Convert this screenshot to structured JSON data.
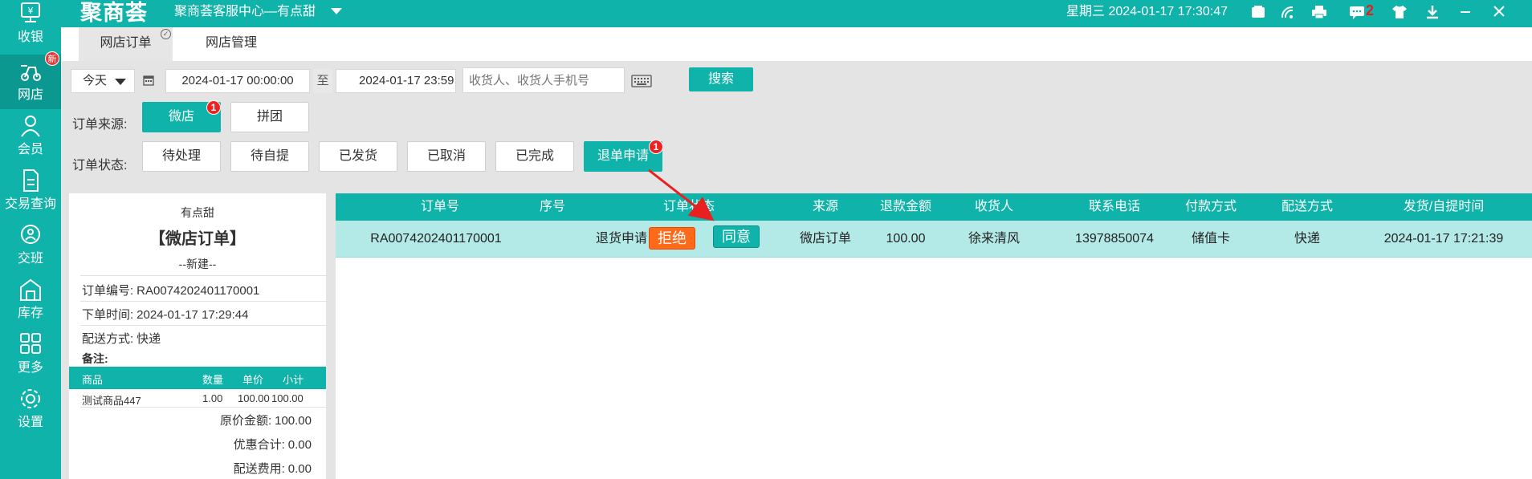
{
  "app": {
    "logo": "聚商荟",
    "store_title": "聚商荟客服中心—有点甜",
    "datetime": "星期三 2024-01-17 17:30:47",
    "message_count": "2",
    "accent_color": "#0fb3a9"
  },
  "sidebar": {
    "items": [
      {
        "label": "收银",
        "icon": "cashier-icon"
      },
      {
        "label": "网店",
        "icon": "online-store-icon",
        "badge": "新"
      },
      {
        "label": "会员",
        "icon": "member-icon"
      },
      {
        "label": "交易查询",
        "icon": "transaction-icon"
      },
      {
        "label": "交班",
        "icon": "shift-icon"
      },
      {
        "label": "库存",
        "icon": "warehouse-icon"
      },
      {
        "label": "更多",
        "icon": "grid-icon"
      },
      {
        "label": "设置",
        "icon": "gear-icon"
      }
    ]
  },
  "tabs": [
    {
      "label": "网店订单",
      "active": true
    },
    {
      "label": "网店管理",
      "active": false
    }
  ],
  "filter": {
    "period": "今天",
    "date_from": "2024-01-17 00:00:00",
    "to_label": "至",
    "date_to": "2024-01-17 23:59",
    "search_placeholder": "收货人、收货人手机号",
    "search_button": "搜索",
    "source_label": "订单来源:",
    "sources": [
      "微店",
      "拼团"
    ],
    "source_badge": "1",
    "status_label": "订单状态:",
    "statuses": [
      "待处理",
      "待自提",
      "已发货",
      "已取消",
      "已完成",
      "退单申请"
    ],
    "status_badge": "1"
  },
  "receipt": {
    "shop": "有点甜",
    "title": "【微店订单】",
    "state": "--新建--",
    "order_no_label": "订单编号:",
    "order_no": "RA0074202401170001",
    "time_label": "下单时间:",
    "time": "2024-01-17 17:29:44",
    "delivery_label": "配送方式:",
    "delivery": "快递",
    "remark_label": "备注:",
    "columns": [
      "商品",
      "数量",
      "单价",
      "小计"
    ],
    "items": [
      {
        "name": "测试商品447",
        "qty": "1.00",
        "price": "100.00",
        "subtotal": "100.00"
      }
    ],
    "original_label": "原价金额:",
    "original": "100.00",
    "discount_label": "优惠合计:",
    "discount": "0.00",
    "shipping_label": "配送费用:",
    "shipping": "0.00"
  },
  "table": {
    "columns": [
      "订单号",
      "序号",
      "订单状态",
      "来源",
      "退款金额",
      "收货人",
      "联系电话",
      "付款方式",
      "配送方式",
      "发货/自提时间"
    ],
    "rows": [
      {
        "order_no": "RA0074202401170001",
        "seq": "",
        "status": "退货申请",
        "reject": "拒绝",
        "agree": "同意",
        "source": "微店订单",
        "refund": "100.00",
        "consignee": "徐来清风",
        "phone": "13978850074",
        "payment": "储值卡",
        "delivery": "快递",
        "time": "2024-01-17 17:21:39"
      }
    ]
  }
}
